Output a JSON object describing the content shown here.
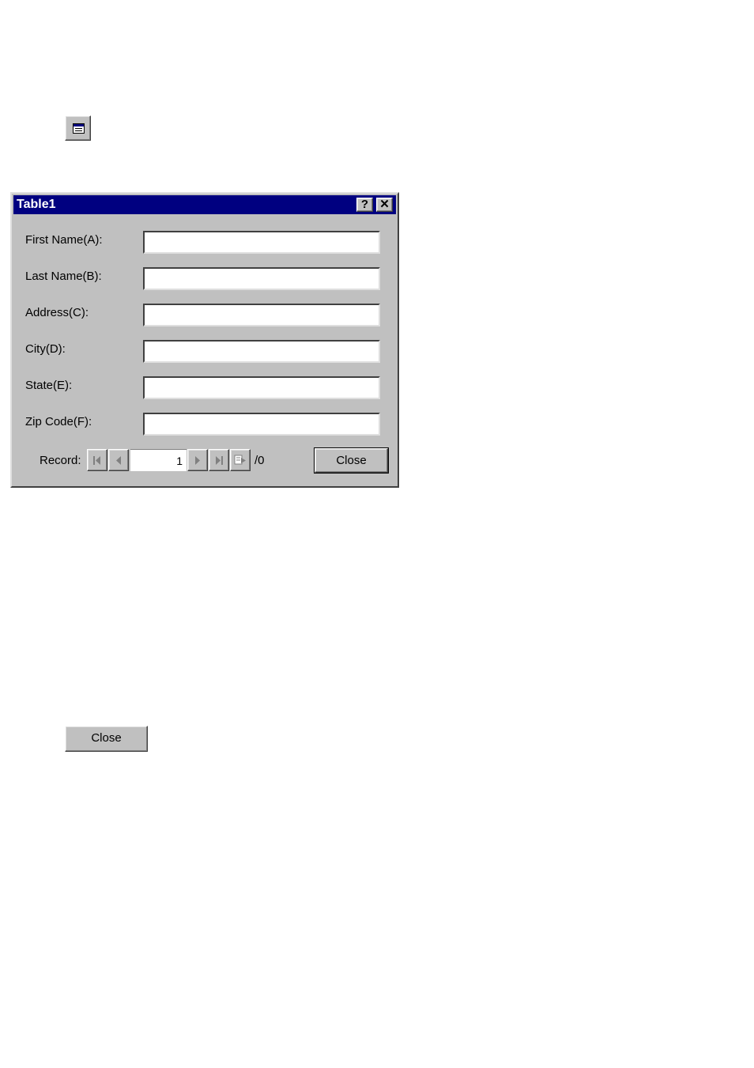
{
  "dialog": {
    "title": "Table1",
    "help_label": "?",
    "close_x_label": "✕",
    "fields": [
      {
        "label": "First Name(A):",
        "value": ""
      },
      {
        "label": "Last Name(B):",
        "value": ""
      },
      {
        "label": "Address(C):",
        "value": ""
      },
      {
        "label": "City(D):",
        "value": ""
      },
      {
        "label": "State(E):",
        "value": ""
      },
      {
        "label": "Zip Code(F):",
        "value": ""
      }
    ],
    "record": {
      "label": "Record:",
      "current": "1",
      "total": "/0"
    },
    "close_label": "Close"
  },
  "toolbar_icon": "form-icon",
  "standalone_close_label": "Close"
}
